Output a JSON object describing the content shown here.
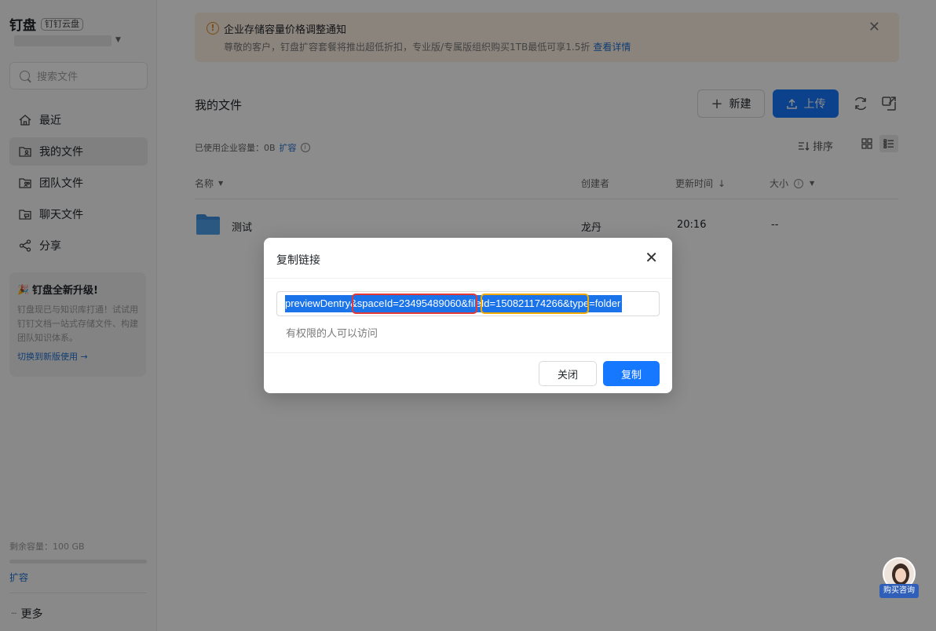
{
  "sidebar": {
    "brand_title": "钉盘",
    "brand_badge": "钉钉云盘",
    "search_placeholder": "搜索文件",
    "nav": [
      {
        "label": "最近",
        "icon": "home-icon"
      },
      {
        "label": "我的文件",
        "icon": "my-files-icon",
        "active": true
      },
      {
        "label": "团队文件",
        "icon": "team-files-icon"
      },
      {
        "label": "聊天文件",
        "icon": "chat-files-icon"
      },
      {
        "label": "分享",
        "icon": "share-icon"
      }
    ],
    "upgrade": {
      "title": "钉盘全新升级!",
      "desc": "钉盘现已与知识库打通！试试用钉钉文档一站式存储文件、构建团队知识体系。",
      "link": "切换到新版使用 →"
    },
    "quota_text": "剩余容量：100 GB",
    "quota_used_fraction": 0,
    "expand": "扩容",
    "more": "更多"
  },
  "banner": {
    "title": "企业存储容量价格调整通知",
    "body": "尊敬的客户，钉盘扩容套餐将推出超低折扣，专业版/专属版组织购买1TB最低可享1.5折",
    "link": "查看详情"
  },
  "main": {
    "title": "我的文件",
    "new_label": "新建",
    "upload_label": "上传",
    "capacity_text": "已使用企业容量：0B",
    "capacity_link": "扩容",
    "sort_label": "排序",
    "columns": {
      "name": "名称",
      "creator": "创建者",
      "updated": "更新时间",
      "size": "大小"
    },
    "rows": [
      {
        "name": "测试",
        "creator": "龙丹",
        "updated": "20:16",
        "size": "--"
      }
    ]
  },
  "modal": {
    "title": "复制链接",
    "link_value": "previewDentry&spaceId=23495489060&fileId=150821174266&type=folder",
    "access_note": "有权限的人可以访问",
    "close_label": "关闭",
    "copy_label": "复制"
  },
  "consult": {
    "label": "购买咨询"
  },
  "colors": {
    "primary": "#1677ff",
    "banner_bg": "#fdf0e3",
    "highlight_red": "#e53935",
    "highlight_orange": "#f2a900"
  }
}
